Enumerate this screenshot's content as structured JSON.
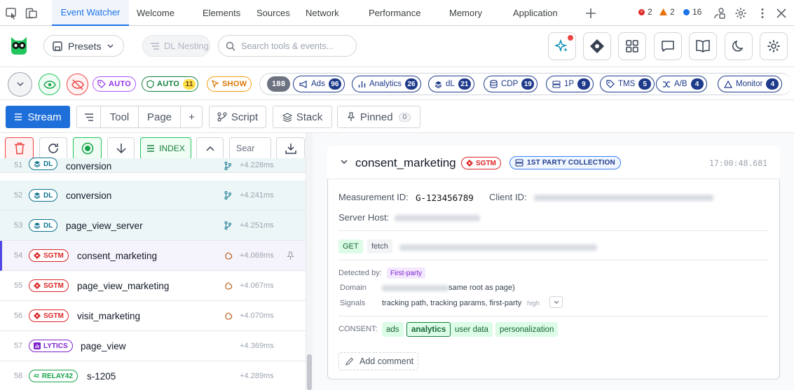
{
  "devtools": {
    "tabs": [
      "Event Watcher",
      "Welcome",
      "Elements",
      "Sources",
      "Network",
      "Performance",
      "Memory",
      "Application"
    ],
    "errors": "2",
    "warnings": "2",
    "messages": "16"
  },
  "header": {
    "presets_label": "Presets",
    "dl_nesting_label": "DL Nesting",
    "search_placeholder": "Search tools & events..."
  },
  "filters": {
    "auto_label": "AUTO",
    "auto2_label": "AUTO",
    "auto2_count": "11",
    "show_label": "SHOW",
    "total": "188",
    "categories": [
      {
        "label": "Ads",
        "count": "96"
      },
      {
        "label": "Analytics",
        "count": "26"
      },
      {
        "label": "dL",
        "count": "21"
      },
      {
        "label": "CDP",
        "count": "19"
      },
      {
        "label": "1P",
        "count": "9"
      },
      {
        "label": "TMS",
        "count": "5"
      },
      {
        "label": "A/B",
        "count": "4"
      },
      {
        "label": "Monitor",
        "count": "4"
      }
    ]
  },
  "toolbar": {
    "stream": "Stream",
    "tool": "Tool",
    "page": "Page",
    "plus": "+",
    "script": "Script",
    "stack": "Stack",
    "pinned": "Pinned",
    "pinned_count": "0"
  },
  "actions": {
    "index_label": "INDEX",
    "search_placeholder": "Sear"
  },
  "events": [
    {
      "num": "51",
      "badge": "DL",
      "name": "conversion",
      "time": "+4.228ms"
    },
    {
      "num": "52",
      "badge": "DL",
      "name": "conversion",
      "time": "+4.241ms"
    },
    {
      "num": "53",
      "badge": "DL",
      "name": "page_view_server",
      "time": "+4.251ms"
    },
    {
      "num": "54",
      "badge": "SGTM",
      "name": "consent_marketing",
      "time": "+4.069ms"
    },
    {
      "num": "55",
      "badge": "SGTM",
      "name": "page_view_marketing",
      "time": "+4.067ms"
    },
    {
      "num": "56",
      "badge": "SGTM",
      "name": "visit_marketing",
      "time": "+4.070ms"
    },
    {
      "num": "57",
      "badge": "LYTICS",
      "name": "page_view",
      "time": "+4.369ms"
    },
    {
      "num": "58",
      "badge": "RELAY42",
      "name": "s-1205",
      "time": "+4.289ms"
    }
  ],
  "detail": {
    "title": "consent_marketing",
    "badge": "SGTM",
    "collection": "1ST PARTY COLLECTION",
    "timestamp": "17:00:48.681",
    "measurement_label": "Measurement ID:",
    "measurement_id": "G-123456789",
    "client_label": "Client ID:",
    "server_label": "Server Host:",
    "method": "GET",
    "transport": "fetch",
    "detected_label": "Detected by:",
    "detected_value": "First-party",
    "domain_label": "Domain",
    "domain_suffix": "same root as page)",
    "signals_label": "Signals",
    "signals_value": "tracking path, tracking params, first-party",
    "confidence": "high",
    "consent_label": "CONSENT:",
    "consent": [
      "ads",
      "analytics",
      "user data",
      "personalization"
    ],
    "add_comment": "Add comment"
  },
  "colors": {
    "accent": "#1a73e8",
    "stream": "#1e6fd9",
    "navy": "#1e3a8a"
  }
}
